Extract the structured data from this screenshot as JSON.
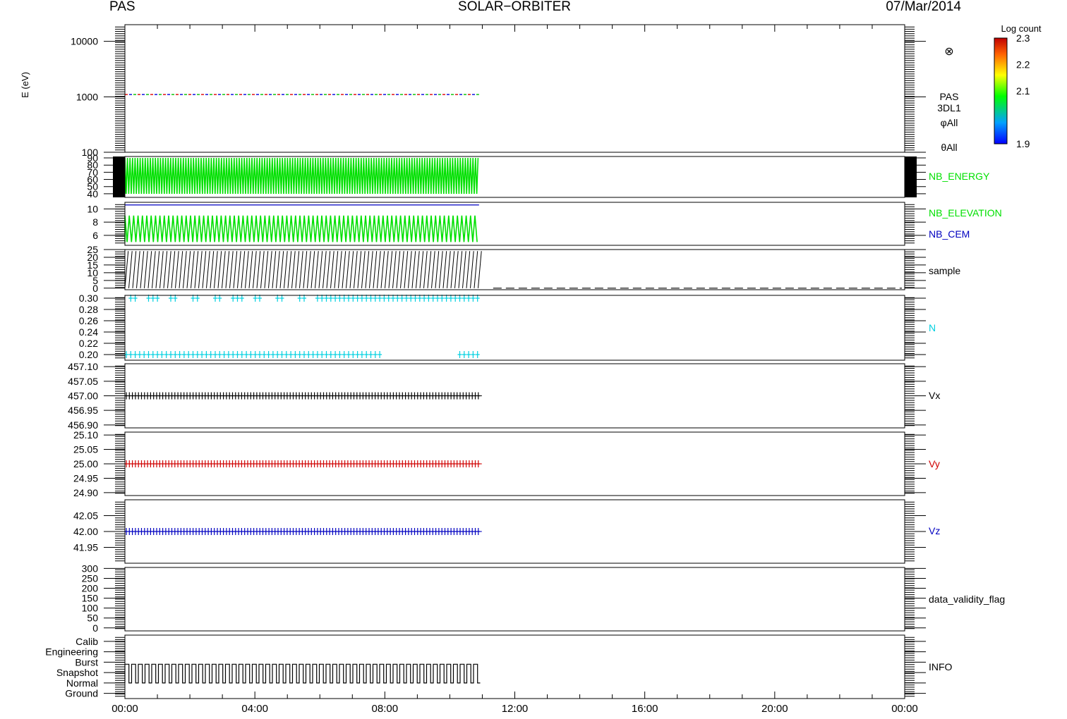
{
  "header": {
    "left": "PAS",
    "center": "SOLAR−ORBITER",
    "right": "07/Mar/2014"
  },
  "time_axis": {
    "ticks": [
      "00:00",
      "04:00",
      "08:00",
      "12:00",
      "16:00",
      "20:00",
      "00:00"
    ],
    "range_hours": [
      0,
      24
    ]
  },
  "colorbar": {
    "title": "Log count",
    "ticks": [
      "2.3",
      "2.2",
      "2.1",
      "1.9"
    ],
    "range": [
      1.9,
      2.3
    ]
  },
  "chart_data": [
    {
      "id": "energy",
      "type": "heatmap",
      "ylabel": "E (eV)",
      "scale": "log",
      "ylim": [
        100,
        20000
      ],
      "ticks": [
        "10000",
        "1000",
        "100"
      ],
      "tick_values": [
        10000,
        1000,
        100
      ],
      "labels": [
        {
          "text": "PAS",
          "color": "#000000"
        },
        {
          "text": "3DL1",
          "color": "#000000"
        },
        {
          "text": "φAll",
          "color": "#000000"
        },
        {
          "text": "θAll",
          "color": "#000000"
        }
      ],
      "symbol": "⊗",
      "series": [
        {
          "band_ev": 1100,
          "x_range": [
            0,
            10.9
          ],
          "value": "2.1"
        }
      ]
    },
    {
      "id": "nb_energy",
      "type": "line",
      "ylim": [
        35,
        92
      ],
      "ticks": [
        "90",
        "80",
        "70",
        "60",
        "50",
        "40"
      ],
      "tick_values": [
        90,
        80,
        70,
        60,
        50,
        40
      ],
      "labels": [
        {
          "text": "NB_ENERGY",
          "color": "#00e000"
        }
      ],
      "series": [
        {
          "color": "#00e000",
          "x_range": [
            0,
            10.9
          ],
          "pattern": "oscillating",
          "y_min": 40,
          "y_max": 90
        }
      ]
    },
    {
      "id": "nb_elevation",
      "type": "line",
      "ylim": [
        4.5,
        11
      ],
      "ticks": [
        "10",
        "8",
        "6"
      ],
      "tick_values": [
        10,
        8,
        6
      ],
      "labels": [
        {
          "text": "NB_ELEVATION",
          "color": "#00e000"
        },
        {
          "text": "NB_CEM",
          "color": "#0000c0"
        }
      ],
      "series": [
        {
          "color": "#00e000",
          "x_range": [
            0,
            10.9
          ],
          "pattern": "oscillating",
          "y_min": 5,
          "y_max": 9
        },
        {
          "color": "#0000c0",
          "x_range": [
            0,
            10.9
          ],
          "pattern": "constant",
          "y": 10.6
        }
      ]
    },
    {
      "id": "sample",
      "type": "line",
      "ylim": [
        -1,
        25
      ],
      "ticks": [
        "25",
        "20",
        "15",
        "10",
        "5",
        "0"
      ],
      "tick_values": [
        25,
        20,
        15,
        10,
        5,
        0
      ],
      "labels": [
        {
          "text": "sample",
          "color": "#000000"
        }
      ],
      "series": [
        {
          "color": "#000000",
          "x_range": [
            0,
            10.9
          ],
          "pattern": "sawtooth",
          "y_min": 0,
          "y_max": 24
        },
        {
          "color": "#000000",
          "x_range": [
            10.9,
            24
          ],
          "pattern": "dashed",
          "y": 0
        }
      ]
    },
    {
      "id": "n",
      "type": "scatter",
      "ylim": [
        0.19,
        0.305
      ],
      "ticks": [
        "0.30",
        "0.28",
        "0.26",
        "0.24",
        "0.22",
        "0.20"
      ],
      "tick_values": [
        0.3,
        0.28,
        0.26,
        0.24,
        0.22,
        0.2
      ],
      "labels": [
        {
          "text": "N",
          "color": "#00d0e0"
        }
      ],
      "series": [
        {
          "color": "#00d0e0",
          "marker": "+",
          "x_range": [
            0,
            10.9
          ],
          "values": [
            0.2,
            0.3
          ]
        }
      ]
    },
    {
      "id": "vx",
      "type": "scatter",
      "ylim": [
        456.89,
        457.11
      ],
      "ticks": [
        "457.10",
        "457.05",
        "457.00",
        "456.95",
        "456.90"
      ],
      "tick_values": [
        457.1,
        457.05,
        457.0,
        456.95,
        456.9
      ],
      "labels": [
        {
          "text": "Vx",
          "color": "#000000"
        }
      ],
      "series": [
        {
          "color": "#000000",
          "marker": "+",
          "x_range": [
            0,
            10.9
          ],
          "y": 457.0
        }
      ]
    },
    {
      "id": "vy",
      "type": "scatter",
      "ylim": [
        24.89,
        25.11
      ],
      "ticks": [
        "25.10",
        "25.05",
        "25.00",
        "24.95",
        "24.90"
      ],
      "tick_values": [
        25.1,
        25.05,
        25.0,
        24.95,
        24.9
      ],
      "labels": [
        {
          "text": "Vy",
          "color": "#d00000"
        }
      ],
      "series": [
        {
          "color": "#d00000",
          "marker": "+",
          "x_range": [
            0,
            10.9
          ],
          "y": 25.0
        }
      ]
    },
    {
      "id": "vz",
      "type": "scatter",
      "ylim": [
        41.9,
        42.1
      ],
      "ticks": [
        "42.05",
        "42.00",
        "41.95"
      ],
      "tick_values": [
        42.05,
        42.0,
        41.95
      ],
      "labels": [
        {
          "text": "Vz",
          "color": "#0000c0"
        }
      ],
      "series": [
        {
          "color": "#0000c0",
          "marker": "+",
          "x_range": [
            0,
            10.9
          ],
          "y": 42.0
        }
      ]
    },
    {
      "id": "validity",
      "type": "line",
      "ylim": [
        -15,
        305
      ],
      "ticks": [
        "300",
        "250",
        "200",
        "150",
        "100",
        "50",
        "0"
      ],
      "tick_values": [
        300,
        250,
        200,
        150,
        100,
        50,
        0
      ],
      "labels": [
        {
          "text": "data_validity_flag",
          "color": "#000000"
        }
      ],
      "series": []
    },
    {
      "id": "info",
      "type": "line",
      "ylim": [
        -0.5,
        5.6
      ],
      "ticks": [
        "Calib",
        "Engineering",
        "Burst",
        "Snapshot",
        "Normal",
        "Ground"
      ],
      "tick_values": [
        5,
        4,
        3,
        2,
        1,
        0
      ],
      "labels": [
        {
          "text": "INFO",
          "color": "#000000"
        }
      ],
      "series": [
        {
          "color": "#000000",
          "x_range": [
            0,
            10.9
          ],
          "pattern": "square",
          "y_min": 1,
          "y_max": 2.8
        }
      ]
    }
  ]
}
